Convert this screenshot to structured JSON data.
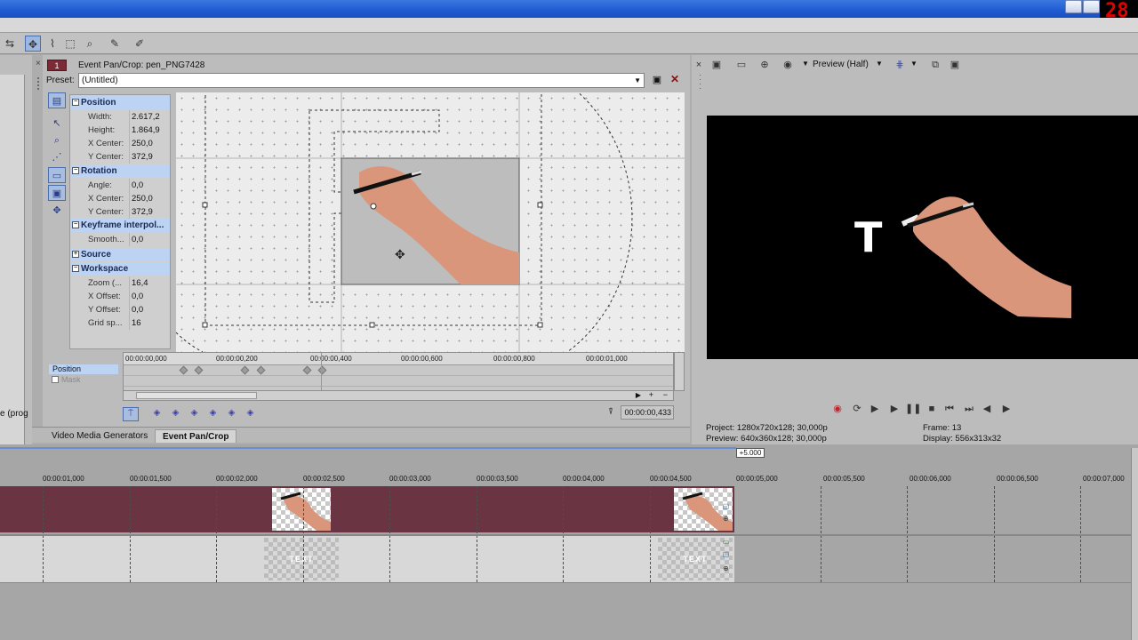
{
  "clock": {
    "text": "28"
  },
  "pancrop": {
    "track_number": "1",
    "title": "Event Pan/Crop: pen_PNG7428",
    "preset_label": "Preset:",
    "preset_value": "(Untitled)",
    "categories": [
      {
        "name": "Position",
        "props": [
          {
            "name": "Width:",
            "value": "2.617,2"
          },
          {
            "name": "Height:",
            "value": "1.864,9"
          },
          {
            "name": "X Center:",
            "value": "250,0"
          },
          {
            "name": "Y Center:",
            "value": "372,9"
          }
        ]
      },
      {
        "name": "Rotation",
        "props": [
          {
            "name": "Angle:",
            "value": "0,0"
          },
          {
            "name": "X Center:",
            "value": "250,0"
          },
          {
            "name": "Y Center:",
            "value": "372,9"
          }
        ]
      },
      {
        "name": "Keyframe interpol...",
        "props": [
          {
            "name": "Smooth...",
            "value": "0,0"
          }
        ]
      },
      {
        "name": "Source",
        "props": []
      },
      {
        "name": "Workspace",
        "props": [
          {
            "name": "Zoom (...",
            "value": "16,4"
          },
          {
            "name": "X Offset:",
            "value": "0,0"
          },
          {
            "name": "Y Offset:",
            "value": "0,0"
          },
          {
            "name": "Grid sp...",
            "value": "16"
          }
        ]
      }
    ],
    "keyframes": {
      "rows": [
        "Position",
        "Mask"
      ],
      "ticks": [
        "00:00:00,000",
        "00:00:00,200",
        "00:00:00,400",
        "00:00:00,600",
        "00:00:00,800",
        "00:00:01,000"
      ],
      "time": "00:00:00,433"
    }
  },
  "left_panel": {
    "cut_text": "e (prog"
  },
  "tabs": [
    "Video Media Generators",
    "Event Pan/Crop"
  ],
  "preview": {
    "quality": "Preview (Half)",
    "info": {
      "project": "Project:  1280x720x128; 30,000p",
      "preview": "Preview:  640x360x128; 30,000p",
      "frame": "Frame:     13",
      "display": "Display:   556x313x32"
    },
    "overlay_text": "T"
  },
  "timeline": {
    "marker": "+5.000",
    "ticks": [
      "00:00:01,000",
      "00:00:01,500",
      "00:00:02,000",
      "00:00:02,500",
      "00:00:03,000",
      "00:00:03,500",
      "00:00:04,000",
      "00:00:04,500",
      "00:00:05,000",
      "00:00:05,500",
      "00:00:06,000",
      "00:00:06,500",
      "00:00:07,000"
    ],
    "text_thumb_label": "TEXT"
  }
}
